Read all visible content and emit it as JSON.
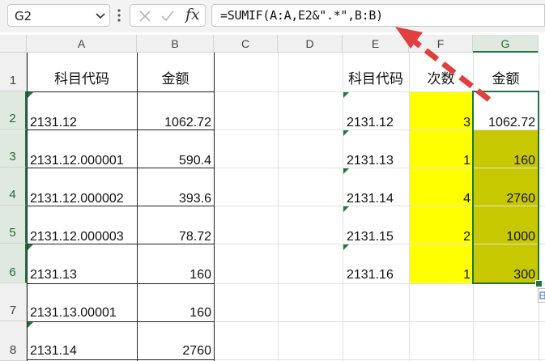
{
  "formula_bar": {
    "name_box": "G2",
    "formula": "=SUMIF(A:A,E2&\".*\",B:B)",
    "cancel_icon": "close-icon",
    "enter_icon": "checkmark-icon",
    "function_icon": "fx-icon",
    "fx_label": "fx"
  },
  "columns": [
    "A",
    "B",
    "C",
    "D",
    "E",
    "F",
    "G"
  ],
  "rows": [
    "1",
    "2",
    "3",
    "4",
    "5",
    "6",
    "7",
    "8"
  ],
  "left_table": {
    "header_code": "科目代码",
    "header_amount": "金额",
    "rows": [
      {
        "code": "2131.12",
        "amount": "1062.72"
      },
      {
        "code": "2131.12.000001",
        "amount": "590.4"
      },
      {
        "code": "2131.12.000002",
        "amount": "393.6"
      },
      {
        "code": "2131.12.000003",
        "amount": "78.72"
      },
      {
        "code": "2131.13",
        "amount": "160"
      },
      {
        "code": "2131.13.00001",
        "amount": "160"
      },
      {
        "code": "2131.14",
        "amount": "2760"
      }
    ]
  },
  "right_table": {
    "header_code": "科目代码",
    "header_count": "次数",
    "header_amount": "金额",
    "rows": [
      {
        "code": "2131.12",
        "count": "3",
        "amount": "1062.72"
      },
      {
        "code": "2131.13",
        "count": "1",
        "amount": "160"
      },
      {
        "code": "2131.14",
        "count": "4",
        "amount": "2760"
      },
      {
        "code": "2131.15",
        "count": "2",
        "amount": "1000"
      },
      {
        "code": "2131.16",
        "count": "1",
        "amount": "300"
      }
    ]
  },
  "colors": {
    "fill_yellow": "#ffff00",
    "fill_olive": "#c8c800",
    "selection": "#217346",
    "annotation_arrow": "#e03a3a"
  }
}
